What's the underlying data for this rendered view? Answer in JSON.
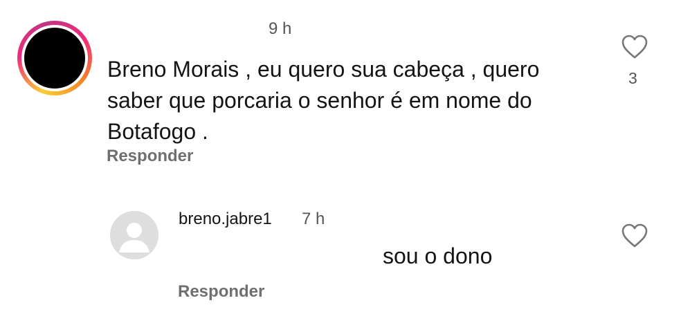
{
  "comment": {
    "time": "9 h",
    "text": "Breno Morais , eu quero sua cabeça , quero saber que porcaria o senhor é em nome do Botafogo .",
    "reply_label": "Responder",
    "like_count": "3",
    "like_icon": "heart-outline-icon"
  },
  "reply": {
    "username": "breno.jabre1",
    "time": "7 h",
    "text": "sou o dono",
    "reply_label": "Responder",
    "like_icon": "heart-outline-icon"
  },
  "colors": {
    "text": "#141414",
    "muted": "#6f6f6f",
    "avatar_placeholder": "#dedede"
  }
}
